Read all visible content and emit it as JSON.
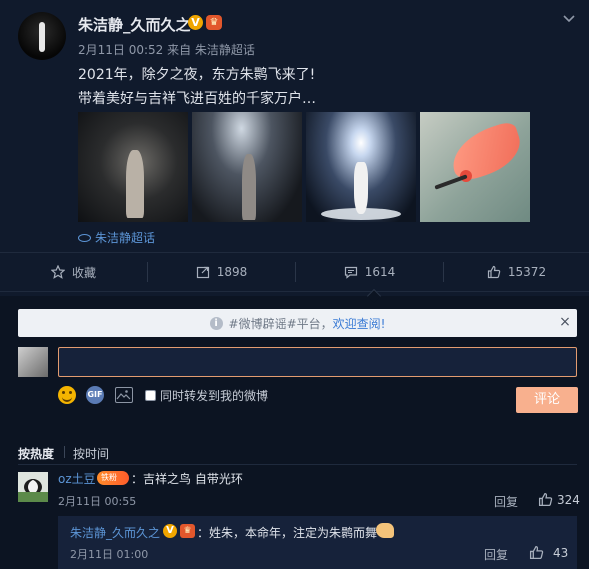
{
  "post": {
    "author": "朱洁静_久而久之",
    "verified_badge": "V",
    "crown_badge": "♛",
    "meta": "2月11日 00:52 来自 朱洁静超话",
    "line1": "2021年，除夕之夜，东方朱鹮飞来了!",
    "line2": "带着美好与吉祥飞进百姓的千家万户…",
    "topic_label": "朱洁静超话"
  },
  "actions": {
    "favorite": "收藏",
    "repost": "1898",
    "comment": "1614",
    "like": "15372"
  },
  "notice": {
    "prefix": "#微博辟谣#平台，",
    "link": "欢迎查阅!",
    "info_glyph": "i",
    "close": "×"
  },
  "composer": {
    "gif_label": "GIF",
    "forward_checkbox_label": "同时转发到我的微博",
    "submit_label": "评论"
  },
  "sort": {
    "by_hot": "按热度",
    "by_time": "按时间"
  },
  "comments": [
    {
      "user": "oz土豆",
      "badge": "铁粉",
      "text": "：吉祥之鸟 自带光环",
      "time": "2月11日 00:55",
      "reply": "回复",
      "likes": "324",
      "replies": [
        {
          "user": "朱洁静_久而久之",
          "text": "：姓朱，本命年，注定为朱鹮而舞",
          "time": "2月11日 01:00",
          "reply": "回复",
          "likes": "43"
        }
      ]
    }
  ],
  "colors": {
    "background": "#101a2c",
    "link": "#5c95d6",
    "submit": "#f8b08e",
    "input_border": "#e39c70"
  }
}
